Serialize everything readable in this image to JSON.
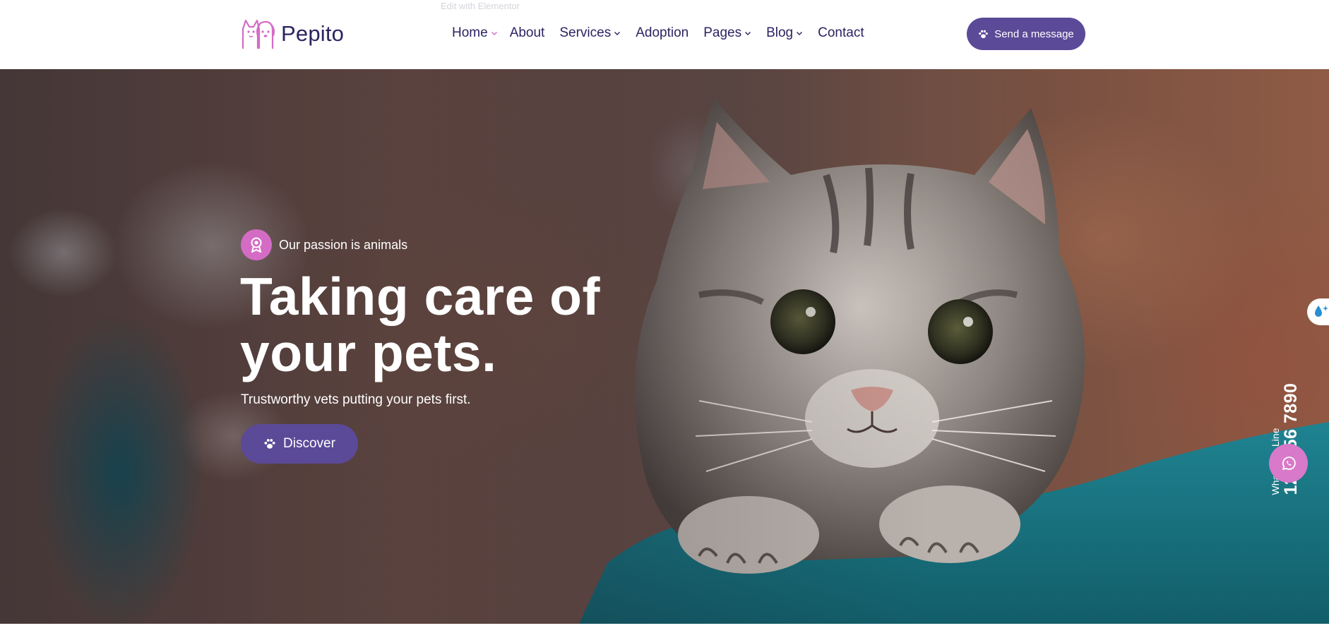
{
  "edit_hint": "Edit with Elementor",
  "brand": {
    "name": "Pepito",
    "logo_icon": "cat-dog-logo-icon",
    "accent_pink": "#d46cc6",
    "accent_purple": "#5b4a98",
    "text_navy": "#2b2461"
  },
  "nav": {
    "items": [
      {
        "label": "Home",
        "has_dropdown": true
      },
      {
        "label": "About",
        "has_dropdown": false
      },
      {
        "label": "Services",
        "has_dropdown": true
      },
      {
        "label": "Adoption",
        "has_dropdown": false
      },
      {
        "label": "Pages",
        "has_dropdown": true
      },
      {
        "label": "Blog",
        "has_dropdown": true
      },
      {
        "label": "Contact",
        "has_dropdown": false
      }
    ]
  },
  "header": {
    "cta_label": "Send a message",
    "cta_icon": "paw-icon"
  },
  "hero": {
    "tagline": "Our passion is animals",
    "tagline_icon": "award-ribbon-icon",
    "headline_line1": "Taking care of",
    "headline_line2": "your pets.",
    "subline": "Trustworthy vets putting your pets first.",
    "button_label": "Discover",
    "button_icon": "paw-icon",
    "image_subject": "kitten-held-by-vet"
  },
  "whatsapp": {
    "label": "WhatsApp Line",
    "number": "123 456 7890",
    "button_icon": "whatsapp-icon",
    "color": "#d879c9"
  },
  "side_tab": {
    "icon": "water-drop-icon"
  }
}
